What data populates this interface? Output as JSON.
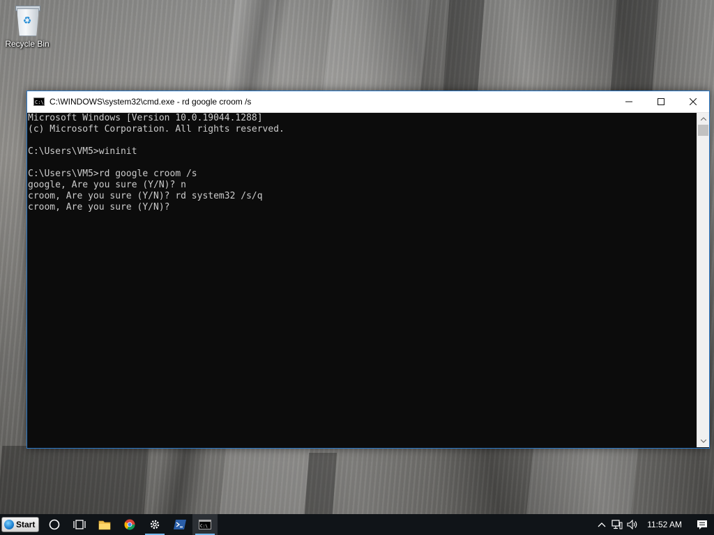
{
  "desktop": {
    "recycle_bin_label": "Recycle Bin"
  },
  "window": {
    "title": "C:\\WINDOWS\\system32\\cmd.exe - rd  google croom /s",
    "console_lines": [
      "Microsoft Windows [Version 10.0.19044.1288]",
      "(c) Microsoft Corporation. All rights reserved.",
      "",
      "C:\\Users\\VM5>wininit",
      "",
      "C:\\Users\\VM5>rd google croom /s",
      "google, Are you sure (Y/N)? n",
      "croom, Are you sure (Y/N)? rd system32 /s/q",
      "croom, Are you sure (Y/N)?"
    ]
  },
  "taskbar": {
    "start_label": "Start",
    "icons": [
      "cortana-icon",
      "task-view-icon",
      "file-explorer-icon",
      "chrome-icon",
      "settings-icon",
      "powershell-icon",
      "cmd-icon"
    ],
    "clock": "11:52 AM"
  },
  "colors": {
    "console_bg": "#0c0c0c",
    "console_text": "#cccccc",
    "taskbar_bg": "#101418",
    "accent": "#76b9ed"
  }
}
